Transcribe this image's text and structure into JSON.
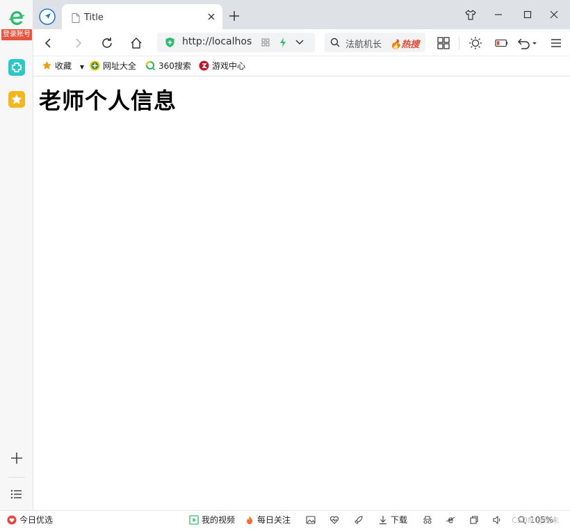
{
  "sidebar": {
    "login_label": "登录账号"
  },
  "tab": {
    "title": "Title"
  },
  "address_bar": {
    "url": "http://localhos"
  },
  "search_box": {
    "text": "法航机长",
    "hot_label": "热搜"
  },
  "bookmarks": [
    {
      "label": "收藏"
    },
    {
      "label": "网址大全"
    },
    {
      "label": "360搜索"
    },
    {
      "label": "游戏中心"
    }
  ],
  "page": {
    "heading": "老师个人信息"
  },
  "status_bar": {
    "today_picks": "今日优选",
    "my_videos": "我的视频",
    "daily_focus": "每日关注",
    "download": "下载",
    "zoom": "105%",
    "watermark": "CSDN @绝末"
  },
  "colors": {
    "brand_green": "#2dbd6e",
    "login_red": "#e8553e",
    "hot_red": "#e8452f",
    "tab_bar": "#dee1e6"
  }
}
